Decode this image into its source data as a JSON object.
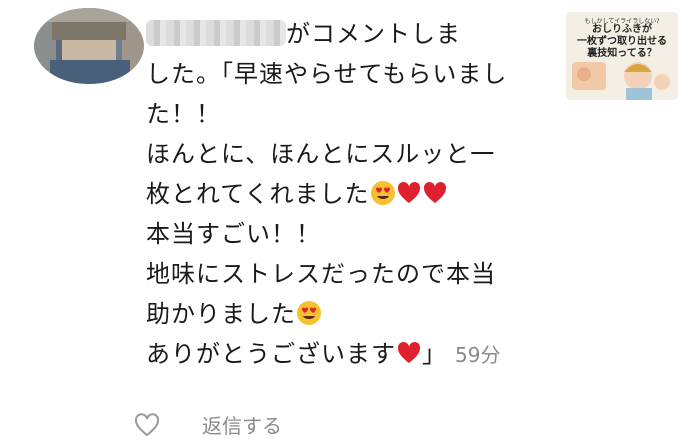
{
  "comment": {
    "header_suffix": "がコメントしま",
    "lines": [
      "した。「早速やらせてもらいまし",
      "た！！",
      "ほんとに、ほんとにスルッと一",
      "枚とれてくれました",
      "本当すごい！！",
      "地味にストレスだったので本当",
      "助かりました",
      "ありがとうございます"
    ],
    "closing_bracket": "」",
    "timestamp": "59分"
  },
  "thumbnail": {
    "top_text": "もしかしてイライラしない?",
    "line1": "おしりふきが",
    "line2": "一枚ずつ取り出せる",
    "line3": "裏技知ってる？"
  },
  "footer": {
    "like_icon": "heart-outline-icon",
    "reply_label": "返信する"
  },
  "colors": {
    "heart": "#e0202e",
    "emoji_face": "#f7c12e",
    "muted_text": "#8a8a8a"
  }
}
